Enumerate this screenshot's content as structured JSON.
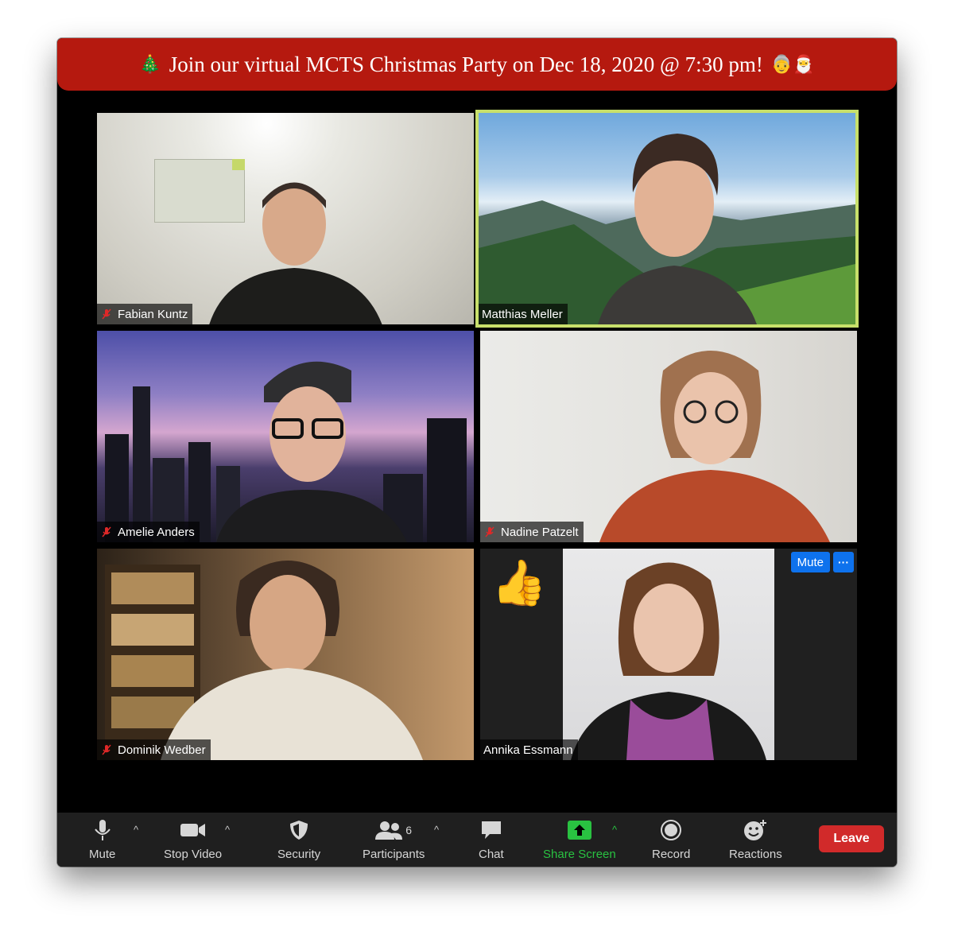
{
  "banner": {
    "text": "Join our virtual MCTS Christmas Party on Dec 18, 2020 @ 7:30 pm!",
    "emoji_left": "🎄",
    "emoji_right": "👵🎅"
  },
  "participants": [
    {
      "name": "Fabian Kuntz",
      "muted": true
    },
    {
      "name": "Matthias Meller",
      "muted": false,
      "active_speaker": true
    },
    {
      "name": "Amelie Anders",
      "muted": true
    },
    {
      "name": "Nadine Patzelt",
      "muted": true
    },
    {
      "name": "Dominik Wedber",
      "muted": true
    },
    {
      "name": "Annika Essmann",
      "muted": false,
      "reaction": "👍",
      "mute_label": "Mute",
      "more_label": "···"
    }
  ],
  "toolbar": {
    "mute": "Mute",
    "stop_video": "Stop Video",
    "security": "Security",
    "participants": "Participants",
    "participants_count": "6",
    "chat": "Chat",
    "share_screen": "Share Screen",
    "record": "Record",
    "reactions": "Reactions",
    "leave": "Leave"
  },
  "colors": {
    "banner": "#b5190f",
    "active_border": "#c8e06b",
    "share_green": "#29c241",
    "leave_red": "#d12a2a",
    "zoom_blue": "#0e72ed"
  }
}
